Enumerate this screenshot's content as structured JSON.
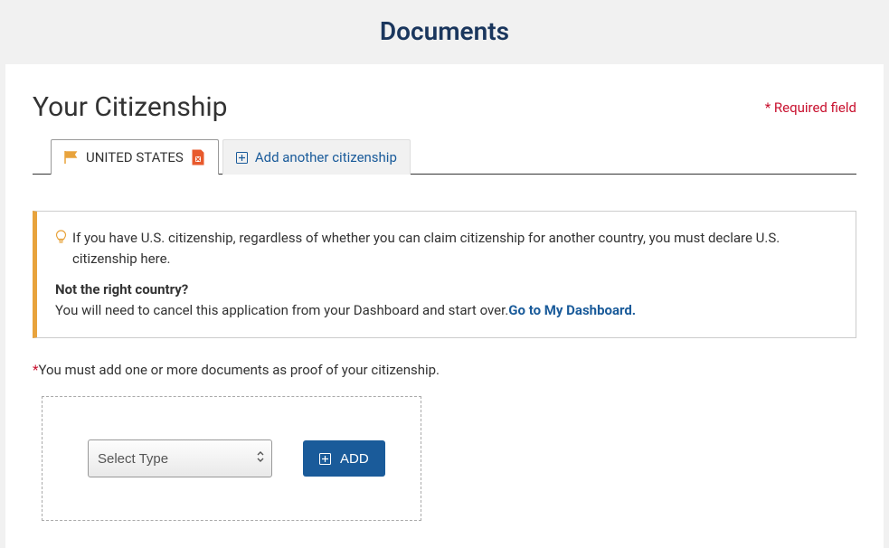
{
  "page": {
    "title": "Documents"
  },
  "section": {
    "title": "Your Citizenship",
    "required_note": "* Required field"
  },
  "tabs": {
    "active": {
      "label": "UNITED STATES"
    },
    "add": {
      "label": "Add another citizenship"
    }
  },
  "info": {
    "line1": "If you have U.S. citizenship, regardless of whether you can claim citizenship for another country, you must declare U.S. citizenship here.",
    "not_right_title": "Not the right country?",
    "not_right_body": "You will need to cancel this application from your Dashboard and start over.",
    "dashboard_link": "Go to My Dashboard."
  },
  "instruction": {
    "text": "You must add one or more documents as proof of your citizenship."
  },
  "form": {
    "select_placeholder": "Select Type",
    "add_button_label": "ADD"
  }
}
